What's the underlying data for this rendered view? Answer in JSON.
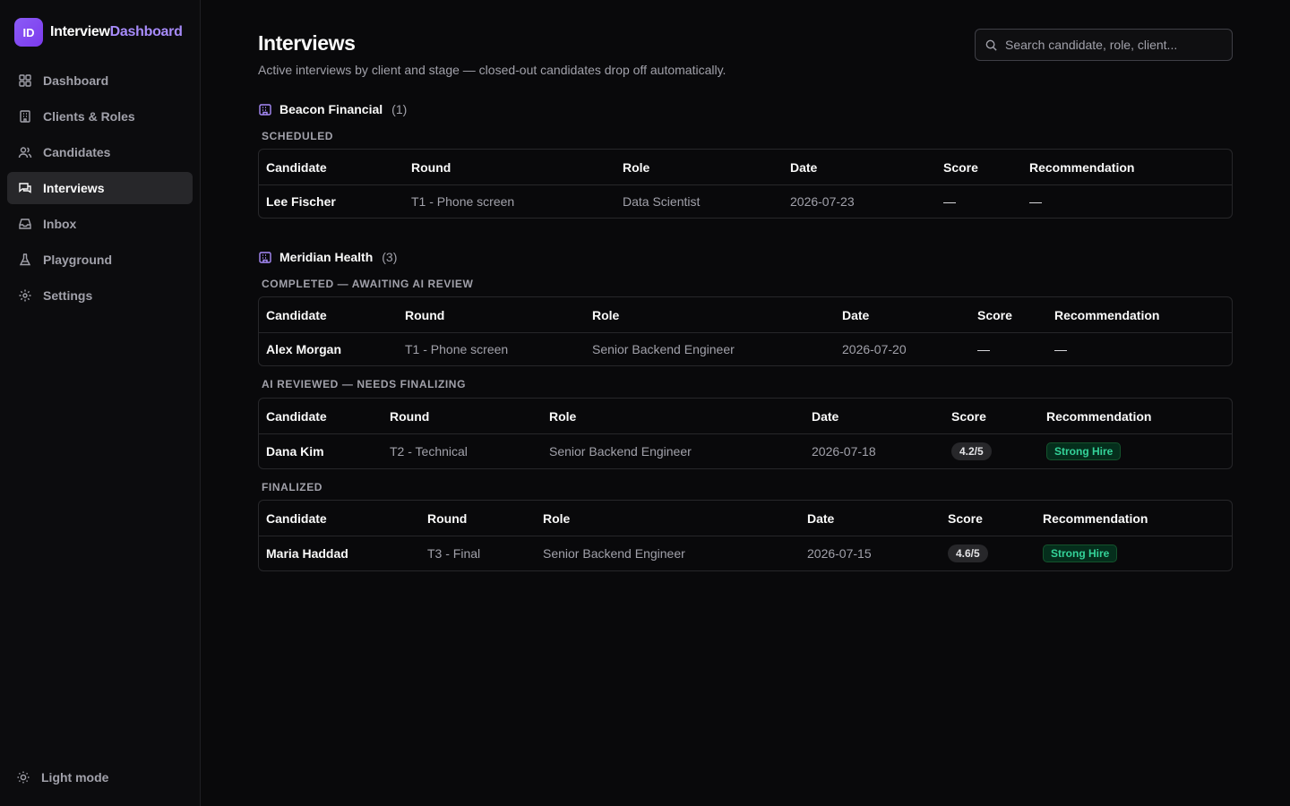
{
  "brand": {
    "logo": "ID",
    "name_a": "Interview",
    "name_b": "Dashboard"
  },
  "sidebar": {
    "items": [
      {
        "label": "Dashboard",
        "icon": "grid-icon",
        "active": false
      },
      {
        "label": "Clients & Roles",
        "icon": "building-icon",
        "active": false
      },
      {
        "label": "Candidates",
        "icon": "users-icon",
        "active": false
      },
      {
        "label": "Interviews",
        "icon": "chat-icon",
        "active": true
      },
      {
        "label": "Inbox",
        "icon": "inbox-icon",
        "active": false
      },
      {
        "label": "Playground",
        "icon": "flask-icon",
        "active": false
      },
      {
        "label": "Settings",
        "icon": "gear-icon",
        "active": false
      }
    ],
    "light_mode": "Light mode"
  },
  "header": {
    "title": "Interviews",
    "subtitle": "Active interviews by client and stage — closed-out candidates drop off automatically.",
    "search_placeholder": "Search candidate, role, client..."
  },
  "columns": [
    "Candidate",
    "Round",
    "Role",
    "Date",
    "Score",
    "Recommendation"
  ],
  "clients": [
    {
      "name": "Beacon Financial",
      "count": "(1)",
      "stages": [
        {
          "label": "SCHEDULED",
          "rows": [
            {
              "candidate": "Lee Fischer",
              "round": "T1 - Phone screen",
              "role": "Data Scientist",
              "date": "2026-07-23",
              "score": "—",
              "recommendation": "—"
            }
          ]
        }
      ]
    },
    {
      "name": "Meridian Health",
      "count": "(3)",
      "stages": [
        {
          "label": "COMPLETED — AWAITING AI REVIEW",
          "rows": [
            {
              "candidate": "Alex Morgan",
              "round": "T1 - Phone screen",
              "role": "Senior Backend Engineer",
              "date": "2026-07-20",
              "score": "—",
              "recommendation": "—"
            }
          ]
        },
        {
          "label": "AI REVIEWED — NEEDS FINALIZING",
          "rows": [
            {
              "candidate": "Dana Kim",
              "round": "T2 - Technical",
              "role": "Senior Backend Engineer",
              "date": "2026-07-18",
              "score": "4.2/5",
              "recommendation": "Strong Hire"
            }
          ]
        },
        {
          "label": "FINALIZED",
          "rows": [
            {
              "candidate": "Maria Haddad",
              "round": "T3 - Final",
              "role": "Senior Backend Engineer",
              "date": "2026-07-15",
              "score": "4.6/5",
              "recommendation": "Strong Hire"
            }
          ]
        }
      ]
    }
  ],
  "colors": {
    "accent": "#8b5cf6",
    "background": "#09090b",
    "success": "#34d399"
  }
}
